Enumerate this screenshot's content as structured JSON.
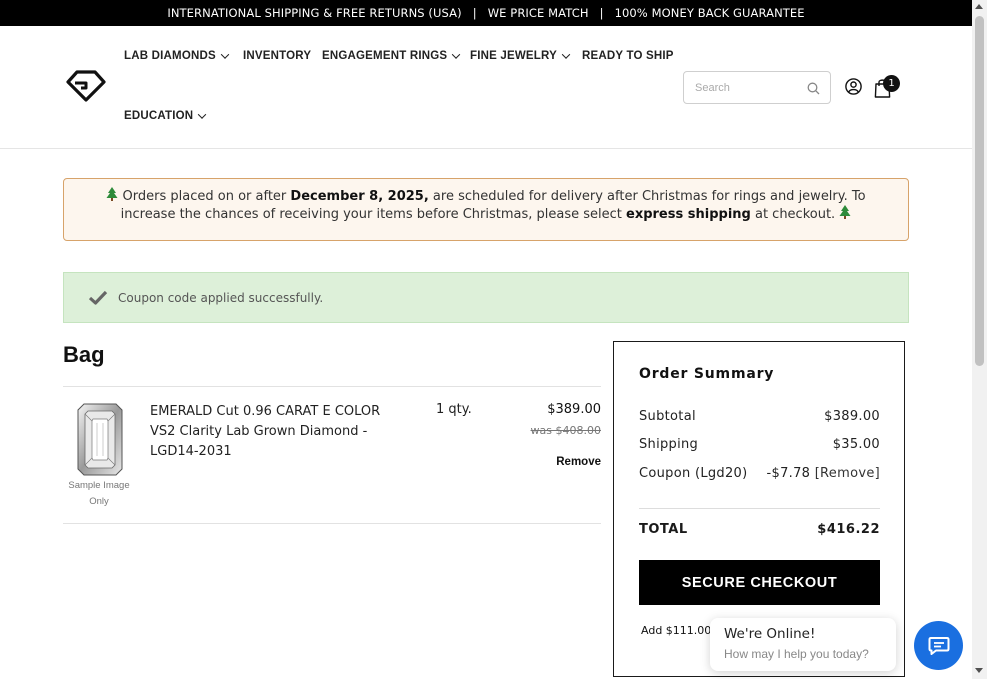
{
  "announcement": {
    "items": [
      "INTERNATIONAL SHIPPING & FREE RETURNS (USA)",
      "WE PRICE MATCH",
      "100% MONEY BACK GUARANTEE"
    ],
    "separator": "|"
  },
  "nav": {
    "items": [
      {
        "label": "LAB DIAMONDS",
        "has_dropdown": true
      },
      {
        "label": "INVENTORY",
        "has_dropdown": false
      },
      {
        "label": "ENGAGEMENT RINGS",
        "has_dropdown": true
      },
      {
        "label": "FINE JEWELRY",
        "has_dropdown": true
      },
      {
        "label": "READY TO SHIP",
        "has_dropdown": false
      },
      {
        "label": "EDUCATION",
        "has_dropdown": true
      }
    ]
  },
  "search": {
    "placeholder": "Search"
  },
  "cart": {
    "count": "1"
  },
  "notice": {
    "text_before": " Orders placed on or after ",
    "date": "December 8, 2025,",
    "text_middle": " are scheduled for delivery after Christmas for rings and jewelry. To increase the chances of receiving your items before Christmas, please select ",
    "emphasis": "express shipping",
    "text_after": " at checkout. "
  },
  "coupon_message": "Coupon code applied successfully.",
  "bag": {
    "title": "Bag",
    "items": [
      {
        "name": "EMERALD Cut 0.96 CARAT E COLOR VS2 Clarity Lab Grown Diamond - LGD14-2031",
        "image_caption": "Sample Image Only",
        "qty": "1 qty.",
        "price": "$389.00",
        "was_price": "was $408.00",
        "remove_label": "Remove"
      }
    ]
  },
  "summary": {
    "title": "Order Summary",
    "subtotal_label": "Subtotal",
    "subtotal": "$389.00",
    "shipping_label": "Shipping",
    "shipping": "$35.00",
    "coupon_label": "Coupon (Lgd20)",
    "coupon_value": "-$7.78",
    "coupon_remove": "[Remove]",
    "total_label": "TOTAL",
    "total": "$416.22",
    "checkout_label": "SECURE CHECKOUT",
    "add_more_text": "Add $111.00 m"
  },
  "chat": {
    "title": "We're Online!",
    "subtitle": "How may I help you today?"
  },
  "colors": {
    "notice_border": "#d7a36a",
    "coupon_bg": "#ddf0d9",
    "chat_button": "#1a6fe0"
  }
}
